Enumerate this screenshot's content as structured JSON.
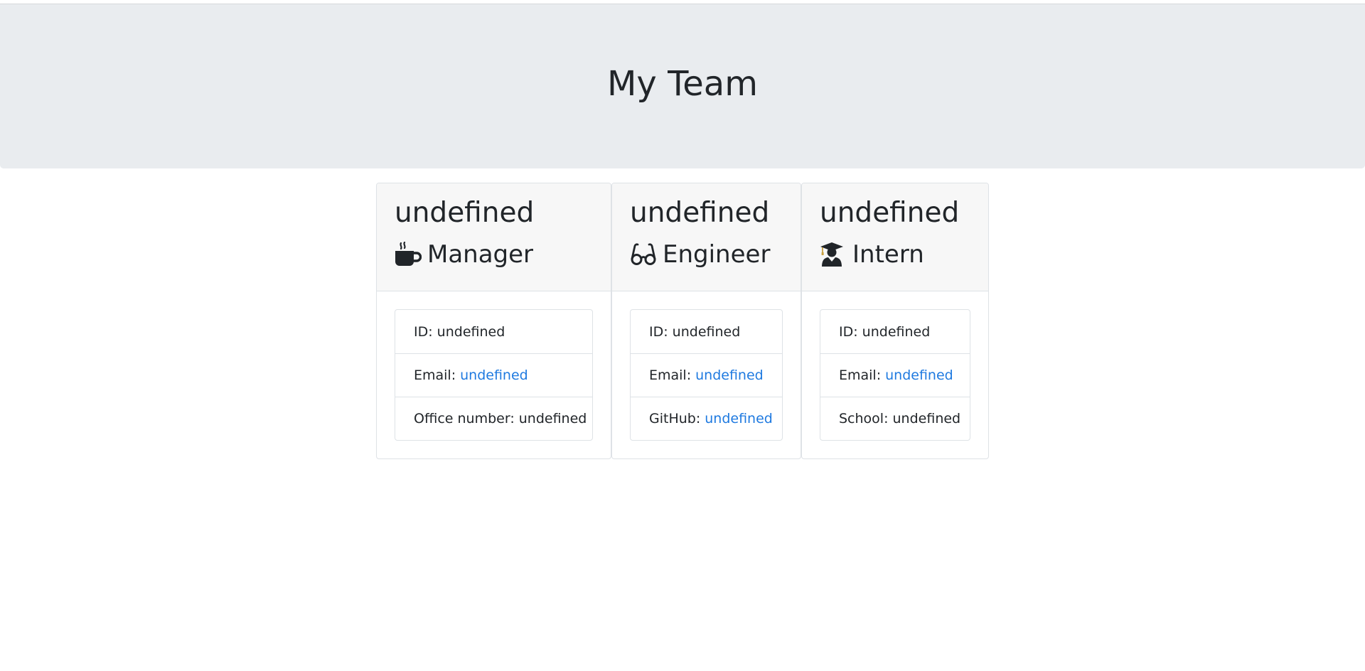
{
  "page": {
    "title": "My Team"
  },
  "cards": [
    {
      "name": "undefined",
      "role": "Manager",
      "icon": "mug-icon",
      "id_label": "ID: undefined",
      "email_label": "Email:",
      "email_value": "undefined",
      "extra_label": "Office number: undefined"
    },
    {
      "name": "undefined",
      "role": "Engineer",
      "icon": "glasses-icon",
      "id_label": "ID: undefined",
      "email_label": "Email:",
      "email_value": "undefined",
      "extra_label": "GitHub:",
      "extra_value": "undefined"
    },
    {
      "name": "undefined",
      "role": "Intern",
      "icon": "graduate-icon",
      "id_label": "ID: undefined",
      "email_label": "Email:",
      "email_value": "undefined",
      "extra_label": "School: undefined"
    }
  ],
  "colors": {
    "link": "#1f7ae0",
    "header_bg": "#e9ecef",
    "card_header_bg": "#f7f7f7",
    "text": "#212529"
  }
}
